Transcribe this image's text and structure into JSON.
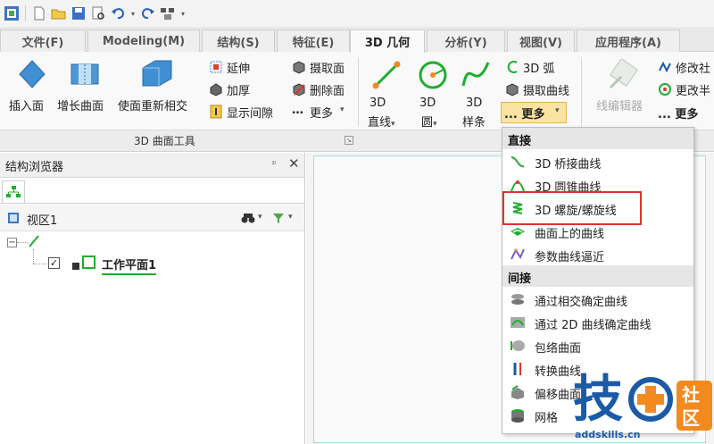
{
  "tabs": [
    {
      "label": "文件(F)"
    },
    {
      "label": "Modeling(M)"
    },
    {
      "label": "结构(S)"
    },
    {
      "label": "特征(E)"
    },
    {
      "label": "3D 几何"
    },
    {
      "label": "分析(Y)"
    },
    {
      "label": "视图(V)"
    },
    {
      "label": "应用程序(A)"
    }
  ],
  "active_tab": "3D 几何",
  "ribbon": {
    "insert_face": "插入面",
    "grow_surface": "增长曲面",
    "reintersect_face": "使面重新相交",
    "extend": "延伸",
    "thicken": "加厚",
    "show_gaps": "显示间隙",
    "extract_face": "摄取面",
    "delete_face": "删除面",
    "more": "更多",
    "line_3d": "3D\n直线",
    "circle_3d": "3D\n圆",
    "spline_3d": "3D\n样条",
    "arc_3d": "3D 弧",
    "extract_curve": "摄取曲线",
    "more_dots": "... 更多",
    "line_editor": "线编辑器",
    "modify_radius": "修改社",
    "change_radius": "更改半",
    "more_right": "... 更多",
    "group_title": "3D 曲面工具"
  },
  "panel": {
    "title": "结构浏览器",
    "pin": "ᵖ",
    "close": "✕",
    "view_label": "视区1",
    "tree_item": "工作平面1"
  },
  "dropdown": {
    "section_direct": "直接",
    "section_indirect": "间接",
    "direct_items": [
      "3D 桥接曲线",
      "3D 圆锥曲线",
      "3D 螺旋/螺旋线",
      "曲面上的曲线",
      "参数曲线逼近"
    ],
    "indirect_items": [
      "通过相交确定曲线",
      "通过 2D 曲线确定曲线",
      "包络曲面",
      "转换曲线",
      "偏移曲面",
      "网格"
    ]
  },
  "watermark": {
    "char": "技",
    "badge_top": "社",
    "badge_bottom": "区",
    "url": "addskills.cn"
  },
  "colors": {
    "accent_green": "#1fae2e",
    "highlight_red": "#e0332b",
    "brand_blue": "#1b5aa6",
    "brand_orange": "#f28a1e"
  }
}
